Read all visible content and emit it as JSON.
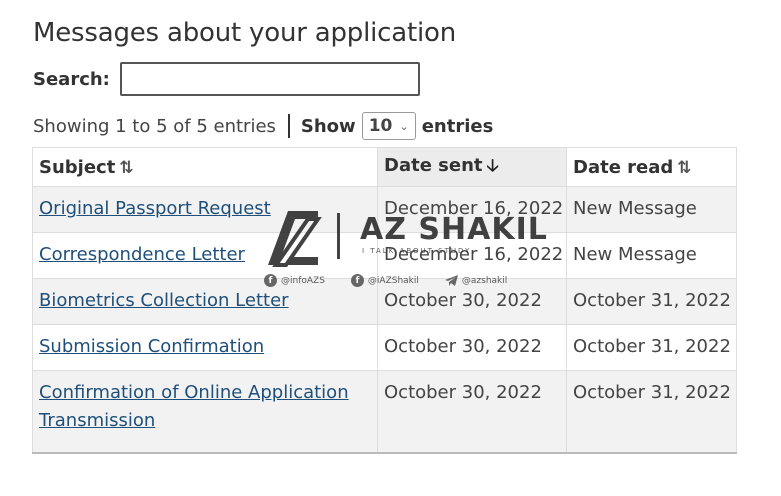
{
  "page_title": "Messages about your application",
  "search": {
    "label": "Search:",
    "value": "",
    "placeholder": ""
  },
  "info": {
    "showing": "Showing 1 to 5 of 5 entries",
    "show_label": "Show",
    "page_size": "10",
    "entries_label": "entries"
  },
  "table": {
    "headers": {
      "subject": "Subject",
      "date_sent": "Date sent",
      "date_read": "Date read"
    },
    "sort": {
      "column": "date_sent",
      "direction": "descending"
    },
    "rows": [
      {
        "subject": "Original Passport Request",
        "date_sent": "December 16, 2022",
        "date_read": "New Message"
      },
      {
        "subject": "Correspondence Letter",
        "date_sent": "December 16, 2022",
        "date_read": "New Message"
      },
      {
        "subject": "Biometrics Collection Letter",
        "date_sent": "October 30, 2022",
        "date_read": "October 31, 2022"
      },
      {
        "subject": "Submission Confirmation",
        "date_sent": "October 30, 2022",
        "date_read": "October 31, 2022"
      },
      {
        "subject": "Confirmation of Online Application Transmission",
        "date_sent": "October 30, 2022",
        "date_read": "October 31, 2022"
      }
    ]
  },
  "watermark": {
    "name": "AZ SHAKIL",
    "tagline": "I TALK ABOUT STUDY",
    "socials": [
      "@infoAZS",
      "@iAZShakil",
      "@azshakil"
    ]
  },
  "colors": {
    "link": "#1f4f7a",
    "stripe": "#f2f2f2",
    "sorted_header": "#ececec"
  },
  "icons": {
    "sort_both": "sort-both-icon",
    "sort_desc": "arrow-down-icon"
  }
}
